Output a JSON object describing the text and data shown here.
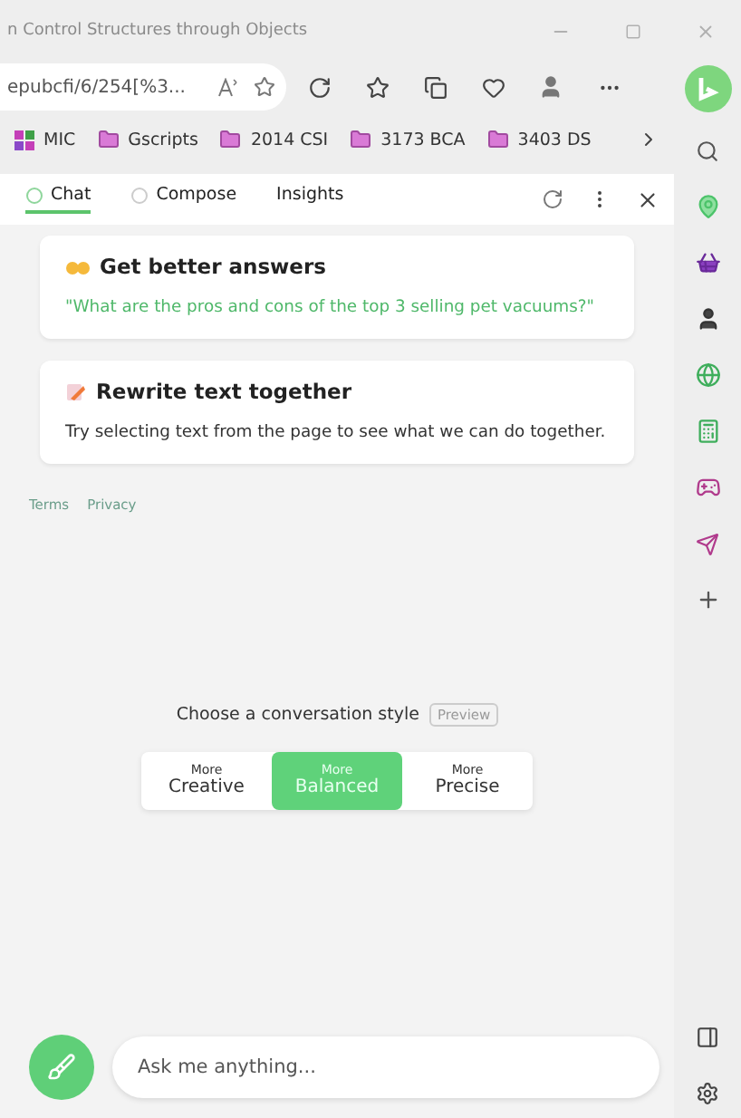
{
  "window": {
    "title": "n Control Structures through Objects"
  },
  "address_bar": {
    "url": "epubcfi/6/254[%3..."
  },
  "favorites": [
    {
      "label": "MIC",
      "kind": "app"
    },
    {
      "label": "Gscripts",
      "kind": "folder"
    },
    {
      "label": "2014 CSI",
      "kind": "folder"
    },
    {
      "label": "3173 BCA",
      "kind": "folder"
    },
    {
      "label": "3403 DS",
      "kind": "folder"
    }
  ],
  "tabs": [
    {
      "label": "Chat",
      "selected": true
    },
    {
      "label": "Compose",
      "selected": false
    },
    {
      "label": "Insights",
      "selected": false
    }
  ],
  "cards": [
    {
      "kind": "tip",
      "title": "Get better answers",
      "body": "\"What are the pros and cons of the top 3 selling pet vacuums?\""
    },
    {
      "kind": "rewrite",
      "title": "Rewrite text together",
      "body": "Try selecting text from the page to see what we can do together."
    }
  ],
  "footer_links": [
    "Terms",
    "Privacy"
  ],
  "style_chooser": {
    "label": "Choose a conversation style",
    "badge": "Preview"
  },
  "styles": [
    {
      "top": "More",
      "label": "Creative",
      "selected": false
    },
    {
      "top": "More",
      "label": "Balanced",
      "selected": true
    },
    {
      "top": "More",
      "label": "Precise",
      "selected": false
    }
  ],
  "input": {
    "placeholder": "Ask me anything..."
  }
}
